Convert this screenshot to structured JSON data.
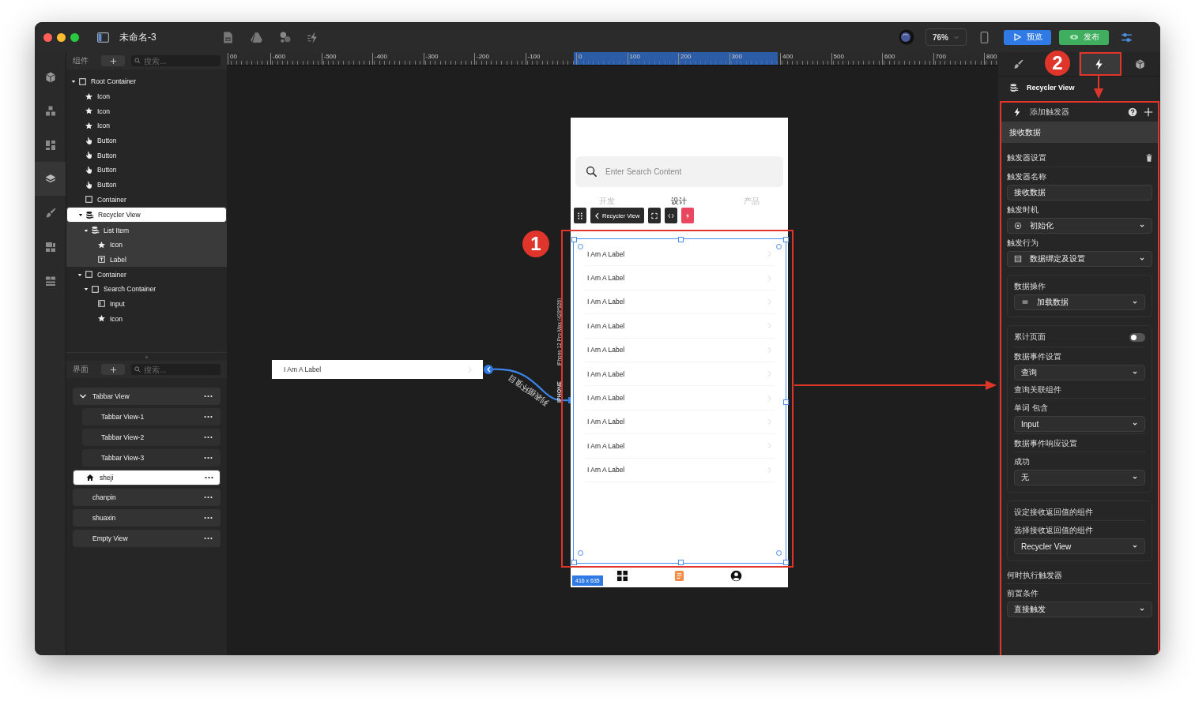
{
  "window": {
    "title": "未命名-3",
    "zoom": "76%",
    "preview_button": "预览",
    "publish_button": "发布"
  },
  "rail_icons": [
    {
      "kind": "cube",
      "selected": false
    },
    {
      "kind": "cubes",
      "selected": false
    },
    {
      "kind": "widgets",
      "selected": false
    },
    {
      "kind": "layers",
      "selected": true
    },
    {
      "kind": "brush",
      "selected": false
    },
    {
      "kind": "layout",
      "selected": false
    },
    {
      "kind": "rows",
      "selected": false
    }
  ],
  "components_panel": {
    "title": "组件",
    "search_placeholder": "搜索...",
    "tree": [
      {
        "label": "Root Container",
        "kind": "container",
        "expanded": true,
        "selected": false,
        "children": [
          {
            "label": "Icon",
            "kind": "icon",
            "selected": false
          },
          {
            "label": "Icon",
            "kind": "icon",
            "selected": false
          },
          {
            "label": "Icon",
            "kind": "icon",
            "selected": false
          },
          {
            "label": "Button",
            "kind": "button",
            "selected": false
          },
          {
            "label": "Button",
            "kind": "button",
            "selected": false
          },
          {
            "label": "Button",
            "kind": "button",
            "selected": false
          },
          {
            "label": "Button",
            "kind": "button",
            "selected": false
          },
          {
            "label": "Container",
            "kind": "container",
            "selected": false
          },
          {
            "label": "Recycler View",
            "kind": "list",
            "expanded": true,
            "selected": true,
            "children": [
              {
                "label": "List Item",
                "kind": "list",
                "expanded": true,
                "selected": false,
                "children": [
                  {
                    "label": "Icon",
                    "kind": "icon",
                    "selected": false
                  },
                  {
                    "label": "Label",
                    "kind": "label",
                    "selected": false
                  }
                ]
              }
            ]
          },
          {
            "label": "Container",
            "kind": "container",
            "expanded": true,
            "selected": false,
            "children": [
              {
                "label": "Search Container",
                "kind": "container",
                "expanded": true,
                "selected": false,
                "children": [
                  {
                    "label": "Input",
                    "kind": "input",
                    "selected": false
                  },
                  {
                    "label": "Icon",
                    "kind": "icon",
                    "selected": false
                  }
                ]
              }
            ]
          }
        ]
      }
    ]
  },
  "pages_panel": {
    "title": "界面",
    "search_placeholder": "搜索...",
    "pages": [
      {
        "label": "Tabbar View",
        "expanded": true,
        "selected": false,
        "home": false,
        "children": [
          {
            "label": "Tabbar View-1",
            "selected": false,
            "home": false
          },
          {
            "label": "Tabbar View-2",
            "selected": false,
            "home": false
          },
          {
            "label": "Tabbar View-3",
            "selected": false,
            "home": false
          }
        ]
      },
      {
        "label": "sheji",
        "selected": true,
        "home": true
      },
      {
        "label": "chanpin",
        "selected": false,
        "home": false
      },
      {
        "label": "shuaxin",
        "selected": false,
        "home": false
      },
      {
        "label": "Empty View",
        "selected": false,
        "home": false
      }
    ]
  },
  "ruler": {
    "labels": [
      {
        "text": "00",
        "highlighted": false
      },
      {
        "text": "-600",
        "highlighted": false
      },
      {
        "text": "-500",
        "highlighted": false
      },
      {
        "text": "-400",
        "highlighted": false
      },
      {
        "text": "-300",
        "highlighted": false
      },
      {
        "text": "-200",
        "highlighted": false
      },
      {
        "text": "-100",
        "highlighted": false
      },
      {
        "text": "0",
        "highlighted": true
      },
      {
        "text": "100",
        "highlighted": true
      },
      {
        "text": "200",
        "highlighted": true
      },
      {
        "text": "300",
        "highlighted": true
      },
      {
        "text": "400",
        "highlighted": false
      },
      {
        "text": "500",
        "highlighted": false
      },
      {
        "text": "600",
        "highlighted": false
      },
      {
        "text": "700",
        "highlighted": false
      },
      {
        "text": "800",
        "highlighted": false
      }
    ]
  },
  "canvas": {
    "floating_item": "I Am A Label",
    "connector_label": "列表循环项目",
    "device_label": "iPhone 12 Pro Max (428*926)",
    "device_tag": "IPHONE",
    "annotation_badge": "1",
    "phone": {
      "search_placeholder": "Enter Search Content",
      "tabs": [
        {
          "label": "开发",
          "selected": false
        },
        {
          "label": "设计",
          "selected": true
        },
        {
          "label": "产品",
          "selected": false
        }
      ],
      "toolbar_component": "Recycler View",
      "list_items": [
        "I Am A Label",
        "I Am A Label",
        "I Am A Label",
        "I Am A Label",
        "I Am A Label",
        "I Am A Label",
        "I Am A Label",
        "I Am A Label",
        "I Am A Label",
        "I Am A Label"
      ],
      "size_badge": "416 x 635",
      "tab_bar": [
        {
          "kind": "grid",
          "selected": false
        },
        {
          "kind": "document",
          "selected": true
        },
        {
          "kind": "person",
          "selected": false
        }
      ]
    }
  },
  "right_panel": {
    "tabs": [
      {
        "kind": "brush",
        "selected": false
      },
      {
        "kind": "trigger",
        "selected": true
      },
      {
        "kind": "component",
        "selected": false
      }
    ],
    "annotation_badge": "2",
    "component": "Recycler View",
    "trigger_header": "添加触发器",
    "trigger_item": "接收数据",
    "trigger_settings": {
      "title": "触发器设置",
      "name_label": "触发器名称",
      "name_value": "接收数据",
      "timing_label": "触发时机",
      "timing_value": "初始化",
      "action_label": "触发行为",
      "action_value": "数据绑定及设置"
    },
    "data_operation": {
      "label": "数据操作",
      "value": "加载数据"
    },
    "data_event": {
      "accumulate_label": "累计页面",
      "accumulate_on": false,
      "event_label": "数据事件设置",
      "event_value": "查询",
      "query_label": "查询关联组件",
      "word_label": "单词 包含",
      "word_value": "Input",
      "response_label": "数据事件响应设置",
      "success_label": "成功",
      "success_value": "无"
    },
    "return_value": {
      "title": "设定接收返回值的组件",
      "select_label": "选择接收返回值的组件",
      "select_value": "Recycler View"
    },
    "execution": {
      "title": "何时执行触发器",
      "condition_label": "前置条件",
      "condition_value": "直接触发"
    }
  }
}
